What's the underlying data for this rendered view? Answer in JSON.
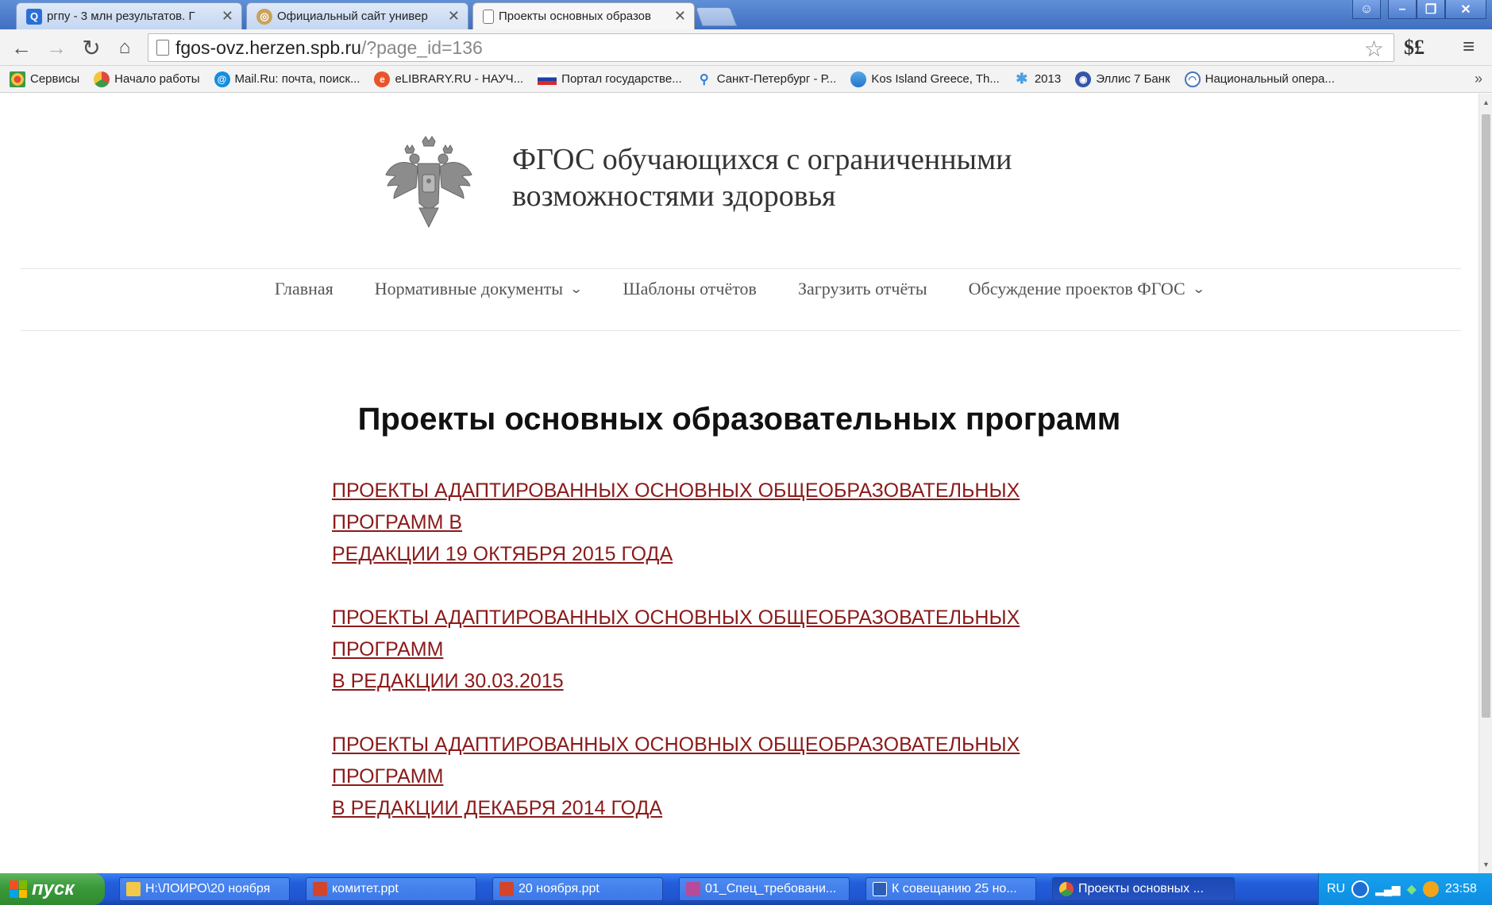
{
  "browser": {
    "tabs": [
      {
        "title": "ргпу - 3 млн результатов. Г",
        "favicon": "search-icon",
        "active": false
      },
      {
        "title": "Официальный сайт универ",
        "favicon": "university-icon",
        "active": false
      },
      {
        "title": "Проекты основных образов",
        "favicon": "page-icon",
        "active": true
      }
    ],
    "url_host": "fgos-ovz.herzen.spb.ru",
    "url_path": "/?page_id=136",
    "extension_label": "$£",
    "bookmarks": [
      {
        "label": "Сервисы",
        "icon": "apps-icon",
        "color": "#e04a3c"
      },
      {
        "label": "Начало работы",
        "icon": "chrome-icon",
        "color": "#e0a020"
      },
      {
        "label": "Mail.Ru: почта, поиск...",
        "icon": "mailru-icon",
        "color": "#168de2"
      },
      {
        "label": "eLIBRARY.RU - НАУЧ...",
        "icon": "elibrary-icon",
        "color": "#e8542a"
      },
      {
        "label": "Портал государстве...",
        "icon": "russia-flag-icon",
        "color": "#1c3fa8"
      },
      {
        "label": "Санкт-Петербург - Р...",
        "icon": "pin-icon",
        "color": "#2a7dd8"
      },
      {
        "label": "Kos Island Greece, Th...",
        "icon": "globe-icon",
        "color": "#2277cc"
      },
      {
        "label": "2013",
        "icon": "star-icon",
        "color": "#4aa0e0"
      },
      {
        "label": "Эллис 7 Банк",
        "icon": "eye-icon",
        "color": "#3355aa"
      },
      {
        "label": "Национальный опера...",
        "icon": "opera-icon",
        "color": "#4477bb"
      }
    ],
    "bookmarks_more": "»"
  },
  "site": {
    "title_line1": "ФГОС обучающихся с ограниченными",
    "title_line2": "возможностями здоровья",
    "nav": [
      {
        "label": "Главная",
        "has_dropdown": false
      },
      {
        "label": "Нормативные документы",
        "has_dropdown": true
      },
      {
        "label": "Шаблоны отчётов",
        "has_dropdown": false
      },
      {
        "label": "Загрузить отчёты",
        "has_dropdown": false
      },
      {
        "label": "Обсуждение проектов ФГОС",
        "has_dropdown": true
      }
    ]
  },
  "content": {
    "heading": "Проекты основных образовательных программ",
    "links": [
      {
        "line1": "ПРОЕКТЫ АДАПТИРОВАННЫХ ОСНОВНЫХ ОБЩЕОБРАЗОВАТЕЛЬНЫХ ПРОГРАММ В",
        "line2": "РЕДАКЦИИ 19 ОКТЯБРЯ 2015 ГОДА"
      },
      {
        "line1": "ПРОЕКТЫ АДАПТИРОВАННЫХ ОСНОВНЫХ ОБЩЕОБРАЗОВАТЕЛЬНЫХ ПРОГРАММ",
        "line2": "В РЕДАКЦИИ 30.03.2015"
      },
      {
        "line1": "ПРОЕКТЫ АДАПТИРОВАННЫХ ОСНОВНЫХ ОБЩЕОБРАЗОВАТЕЛЬНЫХ ПРОГРАММ",
        "line2": "В РЕДАКЦИИ ДЕКАБРЯ 2014 ГОДА"
      }
    ],
    "link_color": "#8b1a1a"
  },
  "taskbar": {
    "start_label": "пуск",
    "buttons": [
      {
        "label": "H:\\ЛОИРО\\20 ноября",
        "icon": "folder-icon",
        "color": "#f2c84b"
      },
      {
        "label": "комитет.ppt",
        "icon": "powerpoint-icon",
        "color": "#d2452b"
      },
      {
        "label": "20 ноября.ppt",
        "icon": "powerpoint-icon",
        "color": "#d2452b"
      },
      {
        "label": "01_Спец_требовани...",
        "icon": "document-icon",
        "color": "#b84a9a"
      },
      {
        "label": "К совещанию 25 но...",
        "icon": "word-icon",
        "color": "#2b5fb8"
      },
      {
        "label": "Проекты основных ...",
        "icon": "chrome-icon",
        "color": "#e0a020"
      }
    ],
    "language": "RU",
    "clock": "23:58"
  }
}
